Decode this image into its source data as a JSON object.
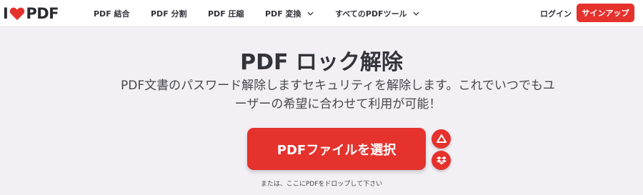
{
  "header": {
    "logo": {
      "prefix": "I",
      "suffix": "PDF",
      "icon": "heart-icon"
    },
    "nav": [
      {
        "label": "PDF 結合"
      },
      {
        "label": "PDF 分割"
      },
      {
        "label": "PDF 圧縮"
      },
      {
        "label": "PDF 変換",
        "dropdown": true
      },
      {
        "label": "すべてのPDFツール",
        "dropdown": true
      }
    ],
    "login_label": "ログイン",
    "signup_label": "サインアップ"
  },
  "main": {
    "title": "PDF ロック解除",
    "subtitle_line1": "PDF文書のパスワード解除しますセキュリティを解除します。これでいつでもユ",
    "subtitle_line2": "ーザーの希望に合わせて利用が可能！",
    "select_button_label": "PDFファイルを選択",
    "cloud_buttons": [
      {
        "icon": "google-drive-icon"
      },
      {
        "icon": "dropbox-icon"
      }
    ],
    "drop_hint": "または、ここにPDFをドロップして下さい"
  },
  "colors": {
    "accent": "#e5322d",
    "background": "#f3f0f5",
    "header_bg": "#ffffff",
    "text": "#33333b"
  }
}
